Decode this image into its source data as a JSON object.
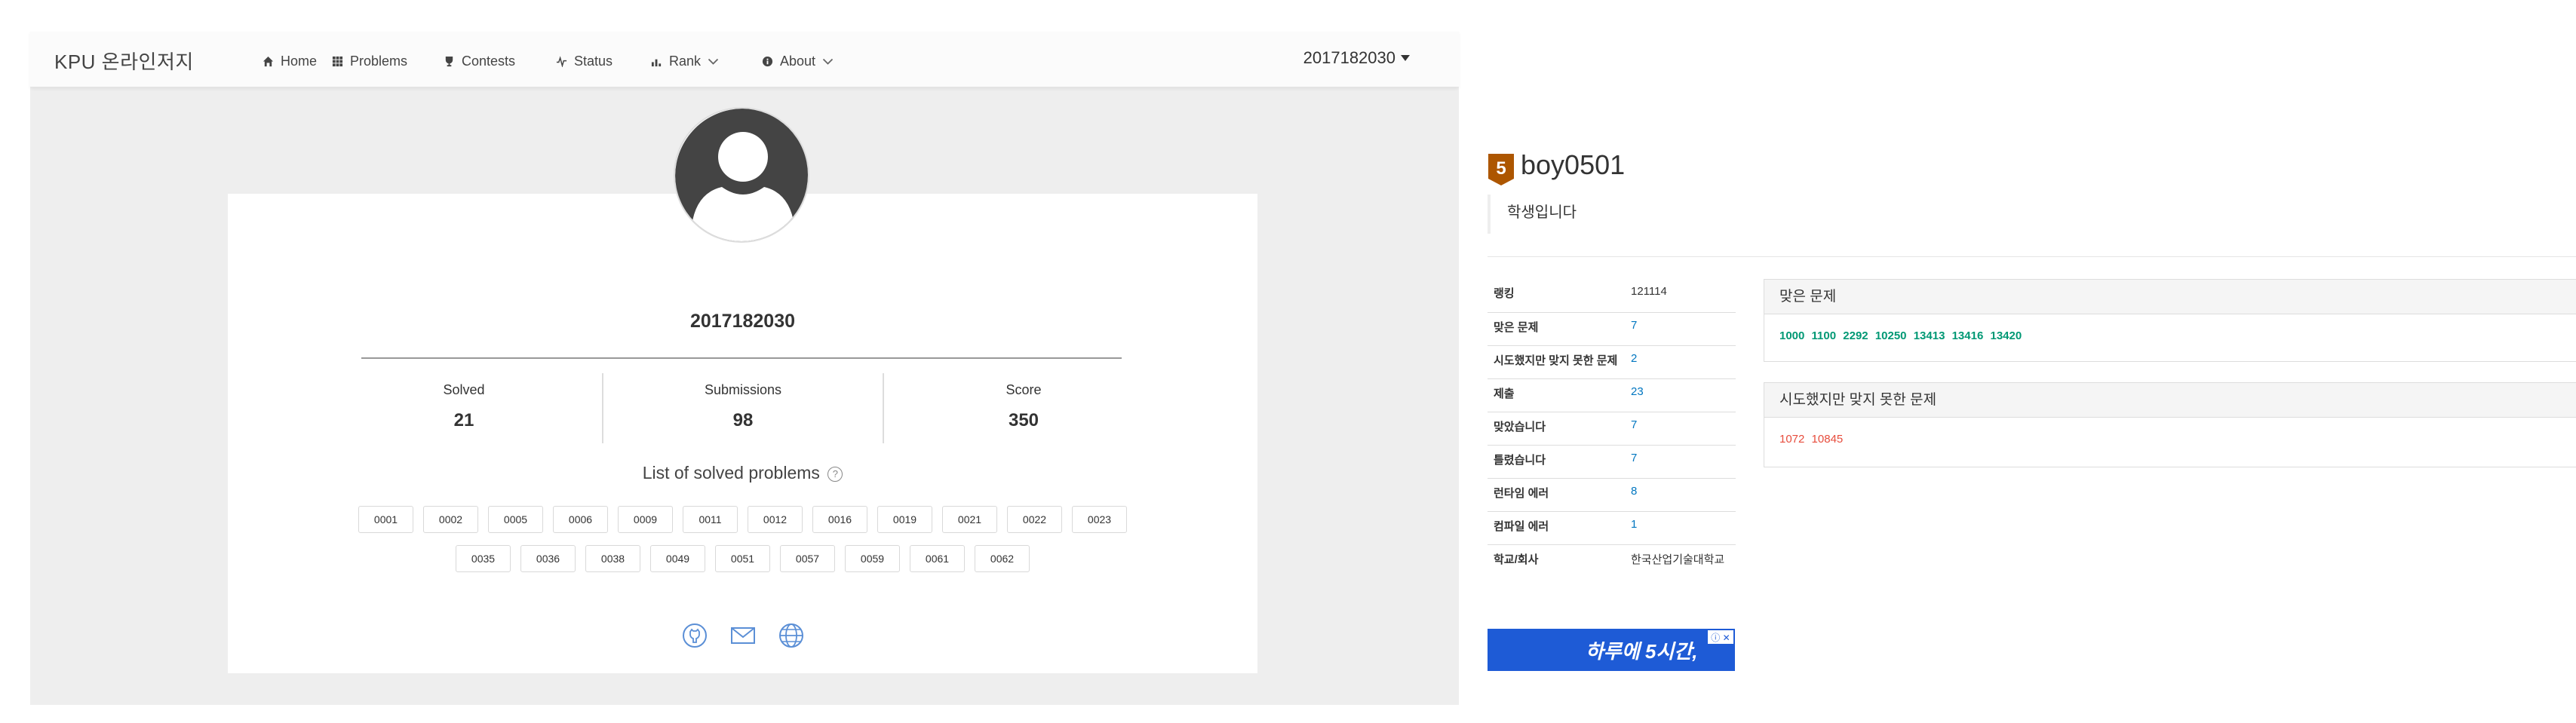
{
  "navbar": {
    "brand": "KPU 온라인저지",
    "items": [
      {
        "label": "Home",
        "icon": "home-icon"
      },
      {
        "label": "Problems",
        "icon": "grid-icon"
      },
      {
        "label": "Contests",
        "icon": "trophy-icon"
      },
      {
        "label": "Status",
        "icon": "pulse-icon"
      },
      {
        "label": "Rank",
        "icon": "bar-chart-icon"
      },
      {
        "label": "About",
        "icon": "info-icon"
      }
    ],
    "user": "2017182030"
  },
  "profile": {
    "username": "2017182030",
    "stats": [
      {
        "label": "Solved",
        "value": "21"
      },
      {
        "label": "Submissions",
        "value": "98"
      },
      {
        "label": "Score",
        "value": "350"
      }
    ],
    "solved_title": "List of solved problems",
    "solved_help": "?",
    "problems_row1": [
      "0001",
      "0002",
      "0005",
      "0006",
      "0009",
      "0011",
      "0012",
      "0016",
      "0019",
      "0021",
      "0022",
      "0023"
    ],
    "problems_row2": [
      "0035",
      "0036",
      "0038",
      "0049",
      "0051",
      "0057",
      "0059",
      "0061",
      "0062"
    ],
    "social_icons": [
      "github-icon",
      "mail-icon",
      "globe-icon"
    ]
  },
  "boj": {
    "tier_number": "5",
    "username": "boy0501",
    "bio": "학생입니다",
    "stats": [
      {
        "key": "랭킹",
        "value": "121114"
      },
      {
        "key": "맞은 문제",
        "value": "7"
      },
      {
        "key": "시도했지만 맞지 못한 문제",
        "value": "2"
      },
      {
        "key": "제출",
        "value": "23"
      },
      {
        "key": "맞았습니다",
        "value": "7"
      },
      {
        "key": "틀렸습니다",
        "value": "7"
      },
      {
        "key": "런타임 에러",
        "value": "8"
      },
      {
        "key": "컴파일 에러",
        "value": "1"
      },
      {
        "key": "학교/회사",
        "value": "한국산업기술대학교"
      }
    ],
    "solved_panel_title": "맞은 문제",
    "solved_list": [
      "1000",
      "1100",
      "2292",
      "10250",
      "13413",
      "13416",
      "13420"
    ],
    "failed_panel_title": "시도했지만 맞지 못한 문제",
    "failed_list": [
      "1072",
      "10845"
    ],
    "ad_text": "하루에 5시간,",
    "ad_close": "ⓘ ✕"
  },
  "colors": {
    "tier_bronze": "#ad5600",
    "solved_green": "#009874",
    "failed_red": "#e74c3c",
    "link_blue": "#0076c0"
  }
}
